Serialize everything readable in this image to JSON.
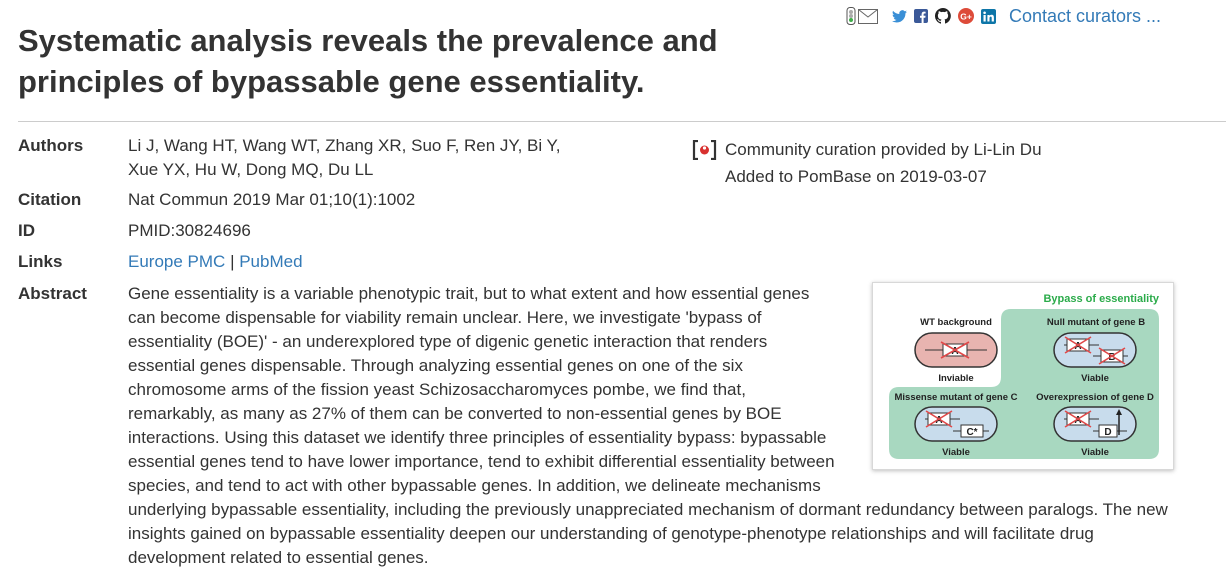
{
  "toolbar": {
    "icons": [
      "traffic-light-icon",
      "email-icon",
      "twitter-icon",
      "facebook-icon",
      "github-icon",
      "google-plus-icon",
      "linkedin-icon"
    ],
    "contact_label": "Contact curators ..."
  },
  "publication": {
    "title": "Systematic analysis reveals the prevalence and principles of bypassable gene essentiality.",
    "authors_label": "Authors",
    "authors": "Li J, Wang HT, Wang WT, Zhang XR, Suo F, Ren JY, Bi Y, Xue YX, Hu W, Dong MQ, Du LL",
    "citation_label": "Citation",
    "citation": "Nat Commun 2019 Mar 01;10(1):1002",
    "id_label": "ID",
    "id": "PMID:30824696",
    "links_label": "Links",
    "links": [
      "Europe PMC",
      "PubMed"
    ],
    "links_separator": "|",
    "abstract_label": "Abstract",
    "abstract": "Gene essentiality is a variable phenotypic trait, but to what extent and how essential genes can become dispensable for viability remain unclear. Here, we investigate 'bypass of essentiality (BOE)' - an underexplored type of digenic genetic interaction that renders essential genes dispensable. Through analyzing essential genes on one of the six chromosome arms of the fission yeast Schizosaccharomyces pombe, we find that, remarkably, as many as 27% of them can be converted to non-essential genes by BOE interactions. Using this dataset we identify three principles of essentiality bypass: bypassable essential genes tend to have lower importance, tend to exhibit differential essentiality between species, and tend to act with other bypassable genes. In addition, we delineate mechanisms underlying bypassable essentiality, including the previously unappreciated mechanism of dormant redundancy between paralogs. The new insights gained on bypassable essentiality deepen our understanding of genotype-phenotype relationships and will facilitate drug development related to essential genes."
  },
  "curation": {
    "provided_by": "Community curation provided by Li-Lin Du",
    "added": "Added to PomBase on 2019-03-07"
  },
  "figure": {
    "heading": "Bypass of essentiality",
    "panels": [
      {
        "title": "WT background",
        "outcome": "Inviable"
      },
      {
        "title": "Null mutant of gene B",
        "outcome": "Viable"
      },
      {
        "title": "Missense mutant of gene C",
        "outcome": "Viable"
      },
      {
        "title": "Overexpression of gene D",
        "outcome": "Viable"
      }
    ],
    "gene_labels": {
      "a": "A",
      "b": "B",
      "c": "C*",
      "d": "D"
    },
    "colors": {
      "heading": "#2bab4a",
      "bypass_bg": "#a8d8c0",
      "inviable_cell": "#e8b4b0",
      "viable_cell": "#c8dcec",
      "crossed_gene": "#e04848"
    }
  }
}
